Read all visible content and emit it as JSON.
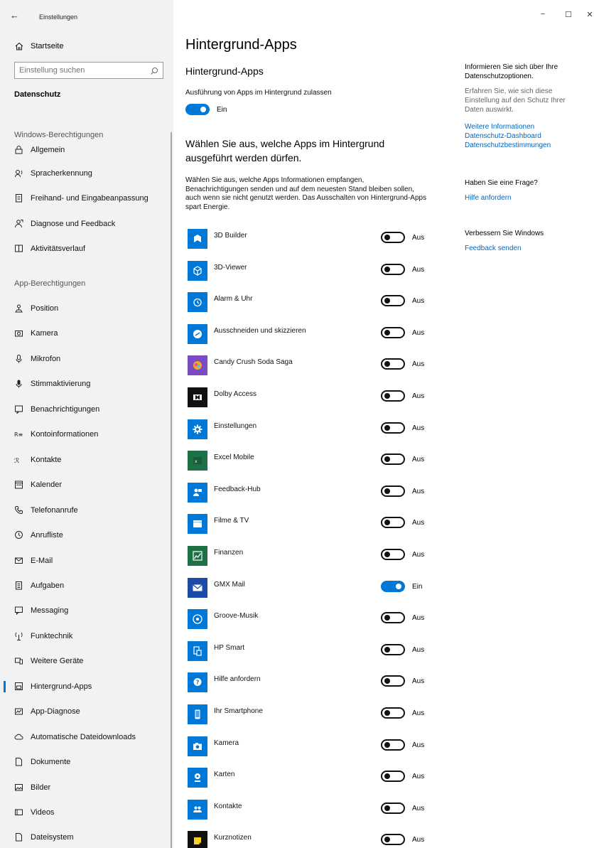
{
  "window": {
    "title": "Einstellungen",
    "back": "←",
    "minimize": "−",
    "maximize": "☐",
    "close": "✕"
  },
  "sidebar": {
    "home": "Startseite",
    "search_placeholder": "Einstellung suchen",
    "current_section": "Datenschutz",
    "windows_group": "Windows-Berechtigungen",
    "windows_items": [
      {
        "label": "Allgemein",
        "icon": "lock-icon"
      },
      {
        "label": "Spracherkennung",
        "icon": "speech-icon"
      },
      {
        "label": "Freihand- und Eingabeanpassung",
        "icon": "ink-icon"
      },
      {
        "label": "Diagnose und Feedback",
        "icon": "feedback-icon"
      },
      {
        "label": "Aktivitätsverlauf",
        "icon": "timeline-icon"
      }
    ],
    "app_group": "App-Berechtigungen",
    "app_items": [
      {
        "label": "Position",
        "icon": "location-icon"
      },
      {
        "label": "Kamera",
        "icon": "camera-icon"
      },
      {
        "label": "Mikrofon",
        "icon": "microphone-icon"
      },
      {
        "label": "Stimmaktivierung",
        "icon": "voice-icon"
      },
      {
        "label": "Benachrichtigungen",
        "icon": "notification-icon"
      },
      {
        "label": "Kontoinformationen",
        "icon": "account-info-icon"
      },
      {
        "label": "Kontakte",
        "icon": "contacts-icon"
      },
      {
        "label": "Kalender",
        "icon": "calendar-icon"
      },
      {
        "label": "Telefonanrufe",
        "icon": "phone-icon"
      },
      {
        "label": "Anrufliste",
        "icon": "history-icon"
      },
      {
        "label": "E-Mail",
        "icon": "mail-icon"
      },
      {
        "label": "Aufgaben",
        "icon": "tasks-icon"
      },
      {
        "label": "Messaging",
        "icon": "chat-icon"
      },
      {
        "label": "Funktechnik",
        "icon": "radio-icon"
      },
      {
        "label": "Weitere Geräte",
        "icon": "devices-icon"
      },
      {
        "label": "Hintergrund-Apps",
        "icon": "background-apps-icon",
        "active": true
      },
      {
        "label": "App-Diagnose",
        "icon": "app-diagnostics-icon"
      },
      {
        "label": "Automatische Dateidownloads",
        "icon": "cloud-icon"
      },
      {
        "label": "Dokumente",
        "icon": "document-icon"
      },
      {
        "label": "Bilder",
        "icon": "picture-icon"
      },
      {
        "label": "Videos",
        "icon": "video-icon"
      },
      {
        "label": "Dateisystem",
        "icon": "file-system-icon"
      }
    ]
  },
  "main": {
    "page_title": "Hintergrund-Apps",
    "section_title": "Hintergrund-Apps",
    "allow_label": "Ausführung von Apps im Hintergrund zulassen",
    "allow_state": "Ein",
    "choose_heading": "Wählen Sie aus, welche Apps im Hintergrund ausgeführt werden dürfen.",
    "description": "Wählen Sie aus, welche Apps Informationen empfangen, Benachrichtigungen senden und auf dem neuesten Stand bleiben sollen, auch wenn sie nicht genutzt werden. Das Ausschalten von Hintergrund-Apps spart Energie.",
    "apps": [
      {
        "name": "3D Builder",
        "state": "Aus",
        "on": false,
        "color": "#0078d7",
        "icon": "3d-builder-icon"
      },
      {
        "name": "3D-Viewer",
        "state": "Aus",
        "on": false,
        "color": "#0078d7",
        "icon": "cube-icon"
      },
      {
        "name": "Alarm & Uhr",
        "state": "Aus",
        "on": false,
        "color": "#0078d7",
        "icon": "alarm-icon"
      },
      {
        "name": "Ausschneiden und skizzieren",
        "state": "Aus",
        "on": false,
        "color": "#0078d7",
        "icon": "snip-icon"
      },
      {
        "name": "Candy Crush Soda Saga",
        "state": "Aus",
        "on": false,
        "color": "#7b4bc4",
        "icon": "candy-icon"
      },
      {
        "name": "Dolby Access",
        "state": "Aus",
        "on": false,
        "color": "#111111",
        "icon": "dolby-icon"
      },
      {
        "name": "Einstellungen",
        "state": "Aus",
        "on": false,
        "color": "#0078d7",
        "icon": "gear-icon"
      },
      {
        "name": "Excel Mobile",
        "state": "Aus",
        "on": false,
        "color": "#1e7145",
        "icon": "excel-icon"
      },
      {
        "name": "Feedback-Hub",
        "state": "Aus",
        "on": false,
        "color": "#0078d7",
        "icon": "feedback-hub-icon"
      },
      {
        "name": "Filme & TV",
        "state": "Aus",
        "on": false,
        "color": "#0078d7",
        "icon": "clapper-icon"
      },
      {
        "name": "Finanzen",
        "state": "Aus",
        "on": false,
        "color": "#1e7145",
        "icon": "finance-chart-icon"
      },
      {
        "name": "GMX Mail",
        "state": "Ein",
        "on": true,
        "color": "#1c4aa8",
        "icon": "envelope-icon"
      },
      {
        "name": "Groove-Musik",
        "state": "Aus",
        "on": false,
        "color": "#0078d7",
        "icon": "music-icon"
      },
      {
        "name": "HP Smart",
        "state": "Aus",
        "on": false,
        "color": "#0078d7",
        "icon": "printer-icon"
      },
      {
        "name": "Hilfe anfordern",
        "state": "Aus",
        "on": false,
        "color": "#0078d7",
        "icon": "help-icon"
      },
      {
        "name": "Ihr Smartphone",
        "state": "Aus",
        "on": false,
        "color": "#0078d7",
        "icon": "smartphone-icon"
      },
      {
        "name": "Kamera",
        "state": "Aus",
        "on": false,
        "color": "#0078d7",
        "icon": "camera-app-icon"
      },
      {
        "name": "Karten",
        "state": "Aus",
        "on": false,
        "color": "#0078d7",
        "icon": "map-pin-icon"
      },
      {
        "name": "Kontakte",
        "state": "Aus",
        "on": false,
        "color": "#0078d7",
        "icon": "people-icon"
      },
      {
        "name": "Kurznotizen",
        "state": "Aus",
        "on": false,
        "color": "#111111",
        "icon": "sticky-note-icon"
      }
    ]
  },
  "right": {
    "info_heading": "Informieren Sie sich über Ihre Datenschutzoptionen.",
    "info_text": "Erfahren Sie, wie sich diese Einstellung auf den Schutz Ihrer Daten auswirkt.",
    "links": [
      "Weitere Informationen",
      "Datenschutz-Dashboard",
      "Datenschutzbestimmungen"
    ],
    "question": "Haben Sie eine Frage?",
    "help_link": "Hilfe anfordern",
    "improve": "Verbessern Sie Windows",
    "feedback_link": "Feedback senden"
  },
  "colors": {
    "accent": "#0078d7",
    "link": "#0067c0",
    "sidebar_bg": "#f2f2f2"
  }
}
